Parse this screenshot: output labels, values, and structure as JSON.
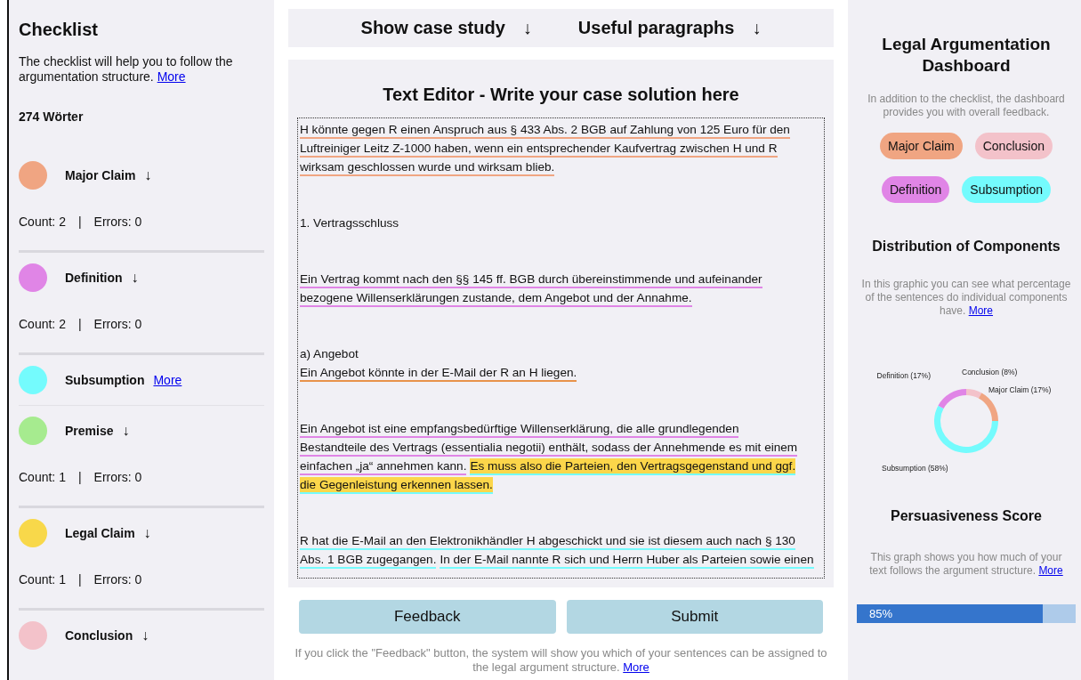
{
  "checklist": {
    "title": "Checklist",
    "intro": "The checklist will help you to follow the argumentation structure.",
    "intro_link": "More",
    "word_count": "274 Wörter",
    "items": [
      {
        "name": "Major Claim",
        "color": "#f0a582",
        "kind": "arrow",
        "icon": "↓",
        "count": "Count: 2",
        "separator": "|",
        "errors": "Errors: 0"
      },
      {
        "name": "Definition",
        "color": "#e085e6",
        "kind": "arrow",
        "icon": "↓",
        "count": "Count: 2",
        "separator": "|",
        "errors": "Errors: 0"
      },
      {
        "name": "Subsumption",
        "color": "#74fbfd",
        "kind": "link",
        "link": "More"
      },
      {
        "name": "Premise",
        "color": "#a6eb8f",
        "kind": "arrow",
        "icon": "↓",
        "count": "Count: 1",
        "separator": "|",
        "errors": "Errors: 0"
      },
      {
        "name": "Legal Claim",
        "color": "#f8d84a",
        "kind": "arrow",
        "icon": "↓",
        "count": "Count: 1",
        "separator": "|",
        "errors": "Errors: 0"
      },
      {
        "name": "Conclusion",
        "color": "#f3c2ca",
        "kind": "arrow",
        "icon": "↓"
      }
    ]
  },
  "top_tabs": [
    {
      "label": "Show case study",
      "icon": "↓"
    },
    {
      "label": "Useful paragraphs",
      "icon": "↓"
    }
  ],
  "editor": {
    "title": "Text Editor - Write your case solution here",
    "paragraphs": [
      [
        [
          {
            "text": "H könnte gegen R einen Anspruch aus § 433 Abs. 2 BGB auf Zahlung von 125 Euro für den",
            "color": "#f0a582",
            "highlighted": false
          }
        ],
        [
          {
            "text": "Luftreiniger Leitz Z-1000 haben, wenn ein entsprechender Kaufvertrag zwischen H und R",
            "color": "#f0a582",
            "highlighted": false
          }
        ],
        [
          {
            "text": "wirksam geschlossen wurde und wirksam blieb.",
            "color": "#f0a582",
            "highlighted": false
          }
        ]
      ],
      [
        [
          {
            "text": "1. Vertragsschluss",
            "highlighted": false
          }
        ]
      ],
      [
        [
          {
            "text": "Ein Vertrag kommt nach den §§ 145 ff. BGB durch übereinstimmende und aufeinander",
            "color": "#e085e6",
            "highlighted": false
          }
        ],
        [
          {
            "text": "bezogene Willenserklärungen zustande, dem Angebot und der Annahme.",
            "color": "#e085e6",
            "highlighted": false
          }
        ]
      ],
      [
        [
          {
            "text": "a) Angebot",
            "highlighted": false
          }
        ],
        [
          {
            "text": "Ein Angebot könnte in der E-Mail der R an H liegen.",
            "color": "#e8924a",
            "highlighted": false
          }
        ]
      ],
      [
        [
          {
            "text": "Ein Angebot ist eine empfangsbedürftige Willenserklärung, die alle grundlegenden",
            "color": "#e085e6",
            "highlighted": false
          }
        ],
        [
          {
            "text": "Bestandteile des Vertrags (essentialia negotii) enthält, sodass der Annehmende es mit einem",
            "color": "#e085e6",
            "highlighted": false
          }
        ],
        [
          {
            "text": "einfachen „ja“ annehmen kann.",
            "color": "#e085e6",
            "highlighted": false
          },
          {
            "text": "Es muss also die Parteien, den Vertragsgegenstand und ggf.",
            "color": "#74fbfd",
            "highlighted": true
          }
        ],
        [
          {
            "text": "die Gegenleistung erkennen lassen.",
            "color": "#74fbfd",
            "highlighted": true
          }
        ]
      ],
      [
        [
          {
            "text": "R hat die E-Mail an den Elektronikhändler H abgeschickt und sie ist diesem auch nach § 130",
            "color": "#74fbfd",
            "highlighted": false
          }
        ],
        [
          {
            "text": "Abs. 1 BGB zugegangen.",
            "color": "#74fbfd",
            "highlighted": false
          },
          {
            "text": "In der E-Mail nannte R sich und Herrn Huber als Parteien sowie einen",
            "color": "#74fbfd",
            "highlighted": false
          }
        ]
      ]
    ]
  },
  "buttons": [
    {
      "label": "Feedback"
    },
    {
      "label": "Submit"
    }
  ],
  "footer": {
    "text": "If you click the \"Feedback\" button, the system will show you which of your sentences can be assigned to the legal argument structure.",
    "link": "More"
  },
  "dashboard": {
    "title": "Legal Argumentation Dashboard",
    "intro": "In addition to the checklist, the dashboard provides you with overall feedback.",
    "tags": [
      {
        "label": "Major Claim",
        "color": "#f0a582"
      },
      {
        "label": "Conclusion",
        "color": "#f3c2ca"
      },
      {
        "label": "Definition",
        "color": "#e085e6"
      },
      {
        "label": "Subsumption",
        "color": "#74fbfd"
      }
    ],
    "distribution": {
      "title": "Distribution of Components",
      "intro": "In this graphic you can see what percentage of the sentences do individual components have.",
      "link": "More",
      "chart_data": {
        "type": "donut",
        "categories": [
          "Conclusion (8%)",
          "Major Claim (17%)",
          "Subsumption (58%)",
          "Definition (17%)"
        ],
        "values": [
          8,
          17,
          58,
          17
        ],
        "colors": [
          "#f3c2ca",
          "#f0a582",
          "#74fbfd",
          "#e085e6"
        ]
      }
    },
    "score": {
      "title": "Persuasiveness Score",
      "intro": "This graph shows you how much of your text follows the argument structure.",
      "link": "More",
      "level": 0.85,
      "reading": "85%"
    }
  }
}
